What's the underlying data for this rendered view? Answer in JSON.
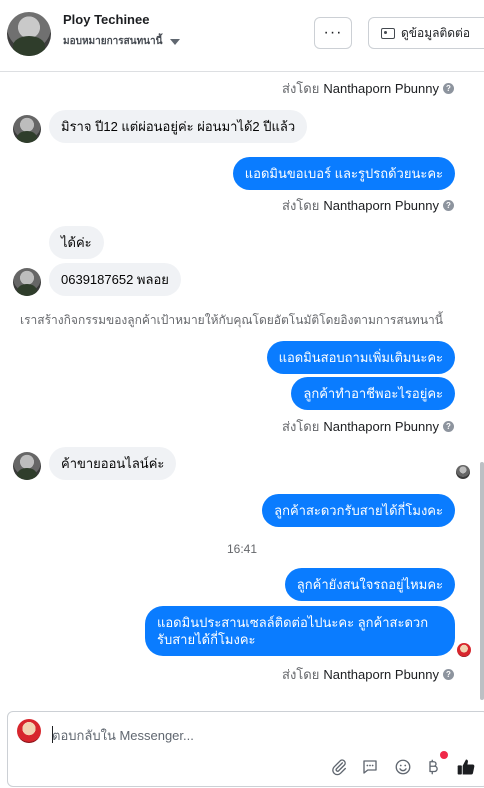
{
  "header": {
    "page_name": "Ploy Techinee",
    "assign_label": "มอบหมายการสนทนานี้",
    "more_label": "···",
    "contact_button": "ดูข้อมูลติดต่อ"
  },
  "messages": {
    "sent_by_prefix": "ส่งโดย",
    "agent_name": "Nanthaporn Pbunny",
    "info_glyph": "?",
    "in_1": "มิราจ  ปี12 แต่ผ่อนอยู่ค่ะ ผ่อนมาได้2 ปีแล้ว",
    "out_1": "แอดมินขอเบอร์ และรูปรถด้วยนะคะ",
    "in_2": "ได้ค่ะ",
    "in_3": "0639187652 พลอย",
    "system_note": "เราสร้างกิจกรรมของลูกค้าเป้าหมายให้กับคุณโดยอัตโนมัติโดยอิงตามการสนทนานี้",
    "out_2": "แอดมินสอบถามเพิ่มเติมนะคะ",
    "out_3": "ลูกค้าทำอาชีพอะไรอยู่คะ",
    "in_4": "ค้าขายออนไลน์ค่ะ",
    "out_4": "ลูกค้าสะดวกรับสายได้กี่โมงคะ",
    "timestamp": "16:41",
    "out_5": "ลูกค้ายังสนใจรถอยู่ไหมคะ",
    "out_6": "แอดมินประสานเซลล์ติดต่อไปนะคะ ลูกค้าสะดวกรับสายได้กี่โมงคะ"
  },
  "composer": {
    "placeholder": "ตอบกลับใน Messenger..."
  },
  "colors": {
    "outgoing_bubble": "#0a7cff",
    "incoming_bubble": "#f0f2f5",
    "like_icon": "#1c1e21",
    "notification_dot": "#f02849"
  },
  "icons": [
    "more-icon",
    "contact-card-icon",
    "chevron-down-icon",
    "attach-icon",
    "saved-reply-icon",
    "emoji-icon",
    "baht-icon",
    "like-icon",
    "info-icon"
  ]
}
